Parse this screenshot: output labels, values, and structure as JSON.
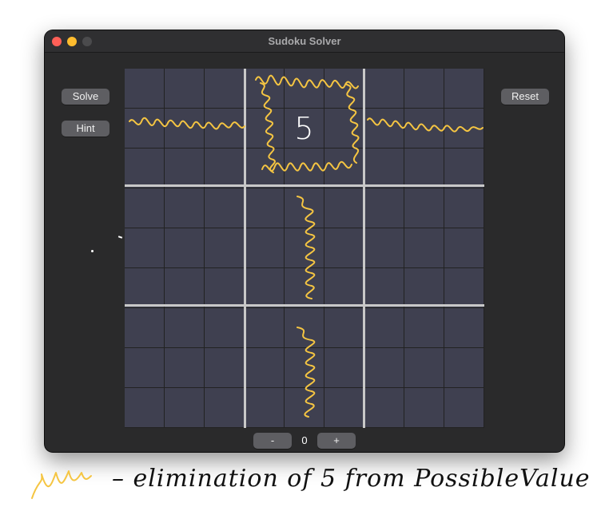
{
  "window": {
    "title": "Sudoku Solver"
  },
  "buttons": {
    "solve": "Solve",
    "hint": "Hint",
    "reset": "Reset"
  },
  "stepper": {
    "minus": "-",
    "value": "0",
    "plus": "+"
  },
  "board": {
    "size": 9,
    "values": [
      [
        "",
        "",
        "",
        "",
        "",
        "",
        "",
        "",
        ""
      ],
      [
        "",
        "",
        "",
        "",
        "5",
        "",
        "",
        "",
        ""
      ],
      [
        "",
        "",
        "",
        "",
        "",
        "",
        "",
        "",
        ""
      ],
      [
        "",
        "",
        "",
        "",
        "",
        "",
        "",
        "",
        ""
      ],
      [
        "",
        "",
        "",
        "",
        "",
        "",
        "",
        "",
        ""
      ],
      [
        "",
        "",
        "",
        "",
        "",
        "",
        "",
        "",
        ""
      ],
      [
        "",
        "",
        "",
        "",
        "",
        "",
        "",
        "",
        ""
      ],
      [
        "",
        "",
        "",
        "",
        "",
        "",
        "",
        "",
        ""
      ],
      [
        "",
        "",
        "",
        "",
        "",
        "",
        "",
        "",
        ""
      ]
    ]
  },
  "annotation": {
    "caption": "– elimination of 5 from PossibleValue",
    "color": "#f5c542"
  }
}
